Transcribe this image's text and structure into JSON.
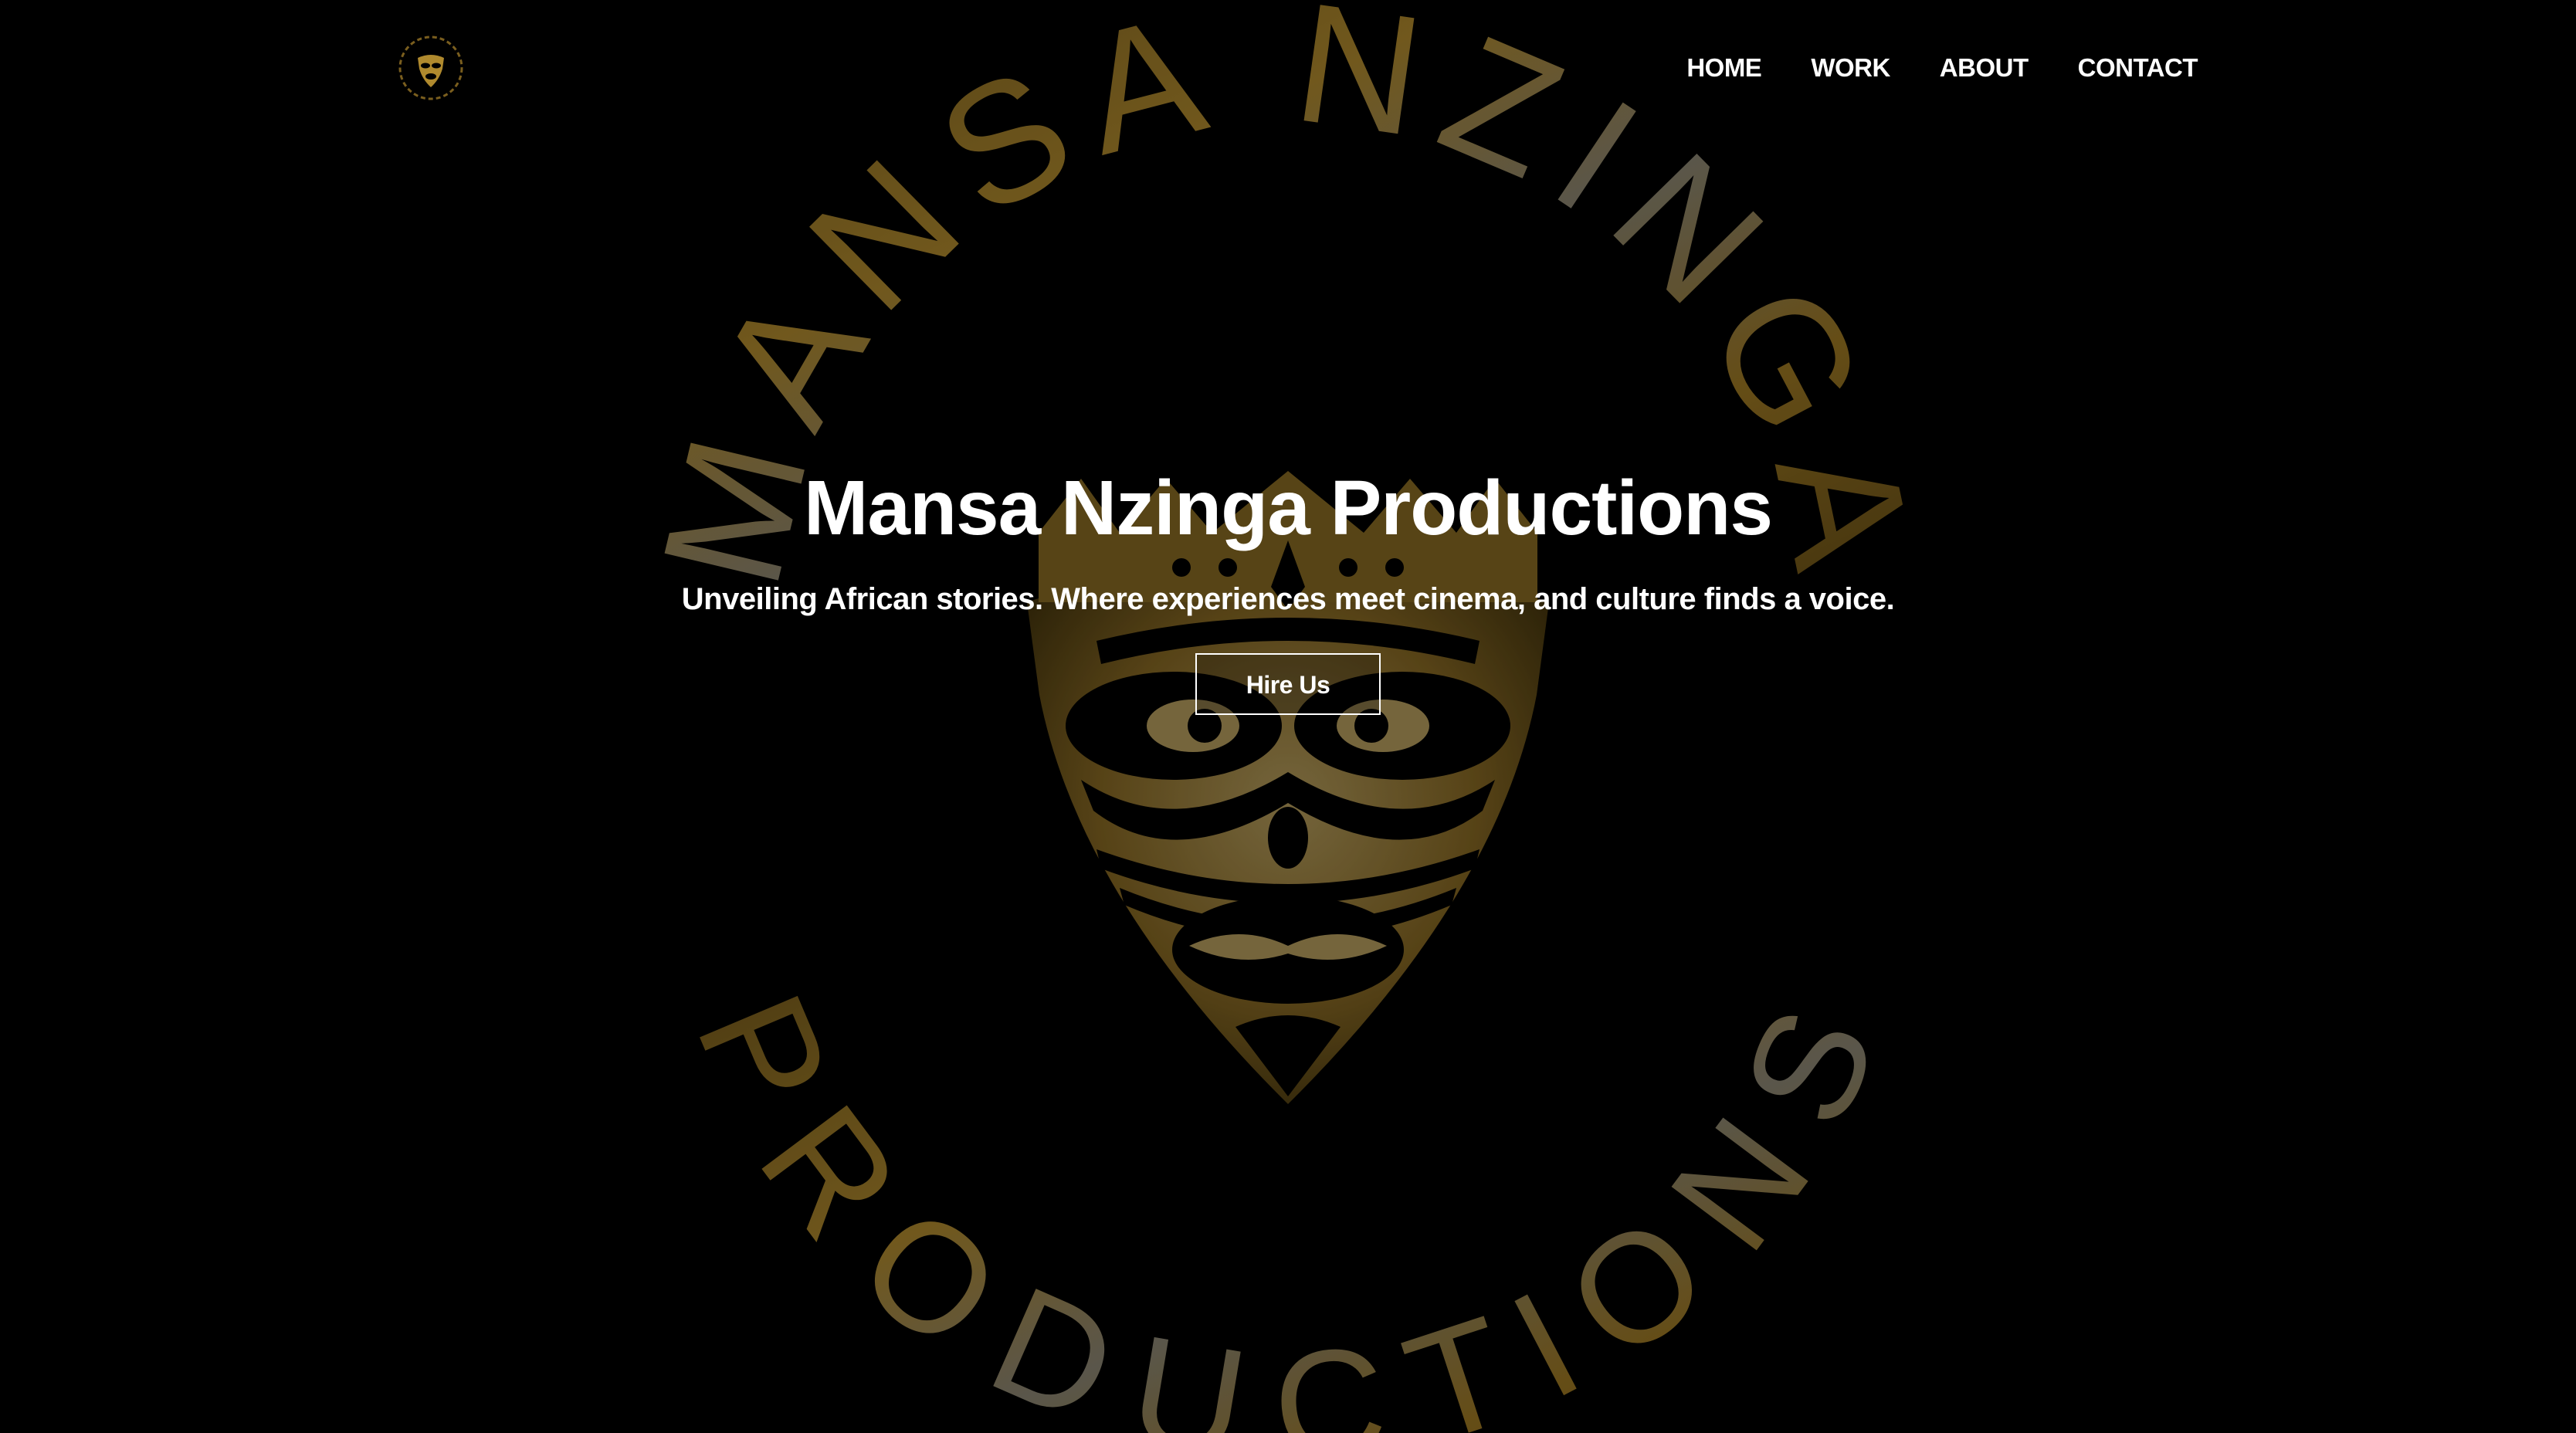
{
  "brand": {
    "logo_icon": "mask-emblem-icon",
    "emblem_top_text": "MANSA NZINGA",
    "emblem_bottom_text": "PRODUCTIONS",
    "gold_color": "#b08a2e"
  },
  "nav": {
    "items": [
      {
        "label": "HOME"
      },
      {
        "label": "WORK"
      },
      {
        "label": "ABOUT"
      },
      {
        "label": "CONTACT"
      }
    ]
  },
  "hero": {
    "title": "Mansa Nzinga Productions",
    "subtitle": "Unveiling African stories. Where experiences meet cinema, and culture finds a voice.",
    "cta_label": "Hire Us"
  },
  "colors": {
    "background": "#000000",
    "text": "#ffffff"
  }
}
